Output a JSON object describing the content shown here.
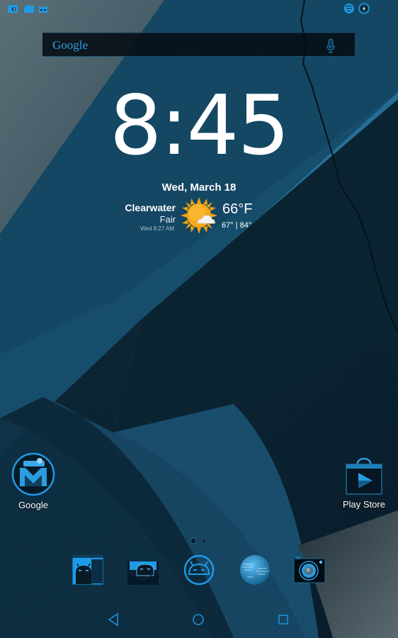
{
  "status_bar": {
    "left_icons": [
      "screenshot-notification-icon",
      "signal-bars-notification-icon",
      "cyanogenmod-mascot-icon"
    ],
    "right_icons": [
      "wifi-globe-icon",
      "battery-charging-icon"
    ],
    "accent": "#1e9be8"
  },
  "search": {
    "logo": "Google",
    "mic_icon": "microphone-icon"
  },
  "clock": {
    "hours": "8",
    "separator": ":",
    "minutes": "45"
  },
  "weather": {
    "date": "Wed, March 18",
    "city": "Clearwater",
    "condition": "Fair",
    "updated": "Wed 8:27 AM",
    "temperature": "66°F",
    "low_high": "67° | 84°",
    "icon": "sun-with-cloud-icon"
  },
  "apps": [
    {
      "label": "Google",
      "icon": "gmail-icon"
    },
    {
      "label": "Play Store",
      "icon": "play-store-icon"
    }
  ],
  "page_indicator": {
    "pages": 2,
    "current": 1
  },
  "dock": [
    {
      "icon": "android-image-app-icon"
    },
    {
      "icon": "android-mail-app-icon"
    },
    {
      "icon": "app-drawer-android-icon"
    },
    {
      "icon": "browser-globe-icon"
    },
    {
      "icon": "camera-icon"
    }
  ],
  "nav": {
    "back": "back-icon",
    "home": "home-icon",
    "recents": "recents-icon"
  },
  "colors": {
    "accent": "#1e9be8",
    "text": "#ffffff"
  }
}
